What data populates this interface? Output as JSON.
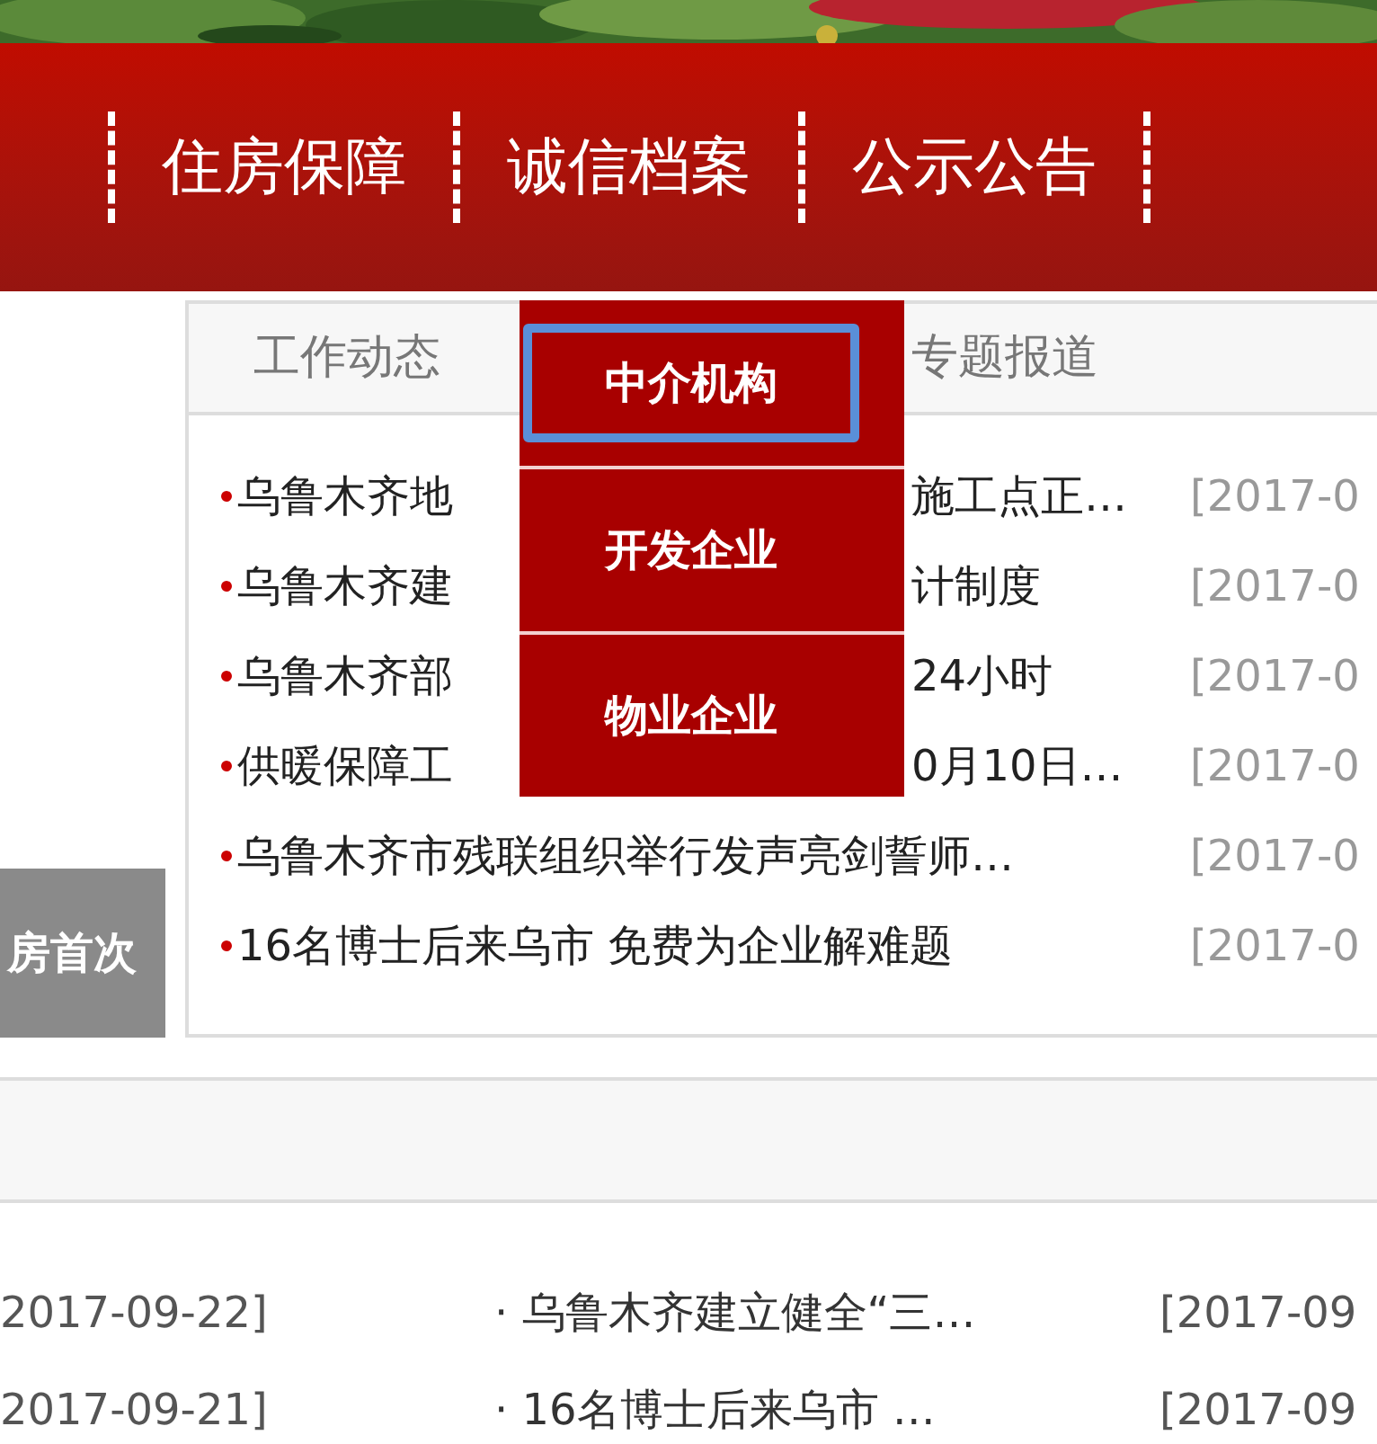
{
  "nav": {
    "items": [
      "住房保障",
      "诚信档案",
      "公示公告"
    ]
  },
  "news_panel": {
    "tabs": [
      "工作动态",
      "专题报道"
    ],
    "dropdown": [
      {
        "label": "中介机构",
        "selected": true
      },
      {
        "label": "开发企业",
        "selected": false
      },
      {
        "label": "物业企业",
        "selected": false
      }
    ],
    "rows": [
      {
        "text": "乌鲁木齐地",
        "text_after": "施工点正…",
        "date": "[2017-0"
      },
      {
        "text": "乌鲁木齐建",
        "text_after": "计制度",
        "date": "[2017-0"
      },
      {
        "text": "乌鲁木齐部",
        "text_after": "24小时",
        "date": "[2017-0"
      },
      {
        "text": "供暖保障工",
        "text_after": "0月10日…",
        "date": "[2017-0"
      },
      {
        "text": "乌鲁木齐市残联组织举行发声亮剑誓师…",
        "date": "[2017-0"
      },
      {
        "text": "16名博士后来乌市 免费为企业解难题",
        "date": "[2017-0"
      }
    ]
  },
  "side_banner": {
    "caption": "房首次"
  },
  "lower_list": {
    "rows": [
      {
        "date_left": "2017-09-22]",
        "title": "· 乌鲁木齐建立健全“三…",
        "date_right": "[2017-09"
      },
      {
        "date_left": "2017-09-21]",
        "title": "· 16名博士后来乌市 …",
        "date_right": "[2017-09"
      }
    ]
  }
}
